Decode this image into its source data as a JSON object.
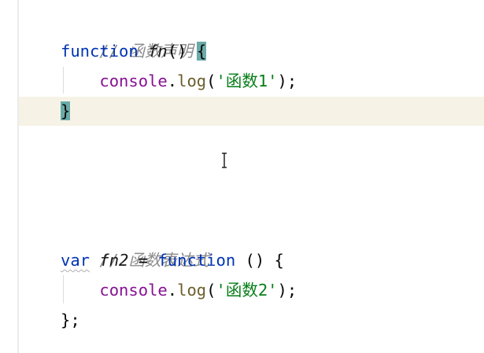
{
  "editor": {
    "lines": [
      {
        "tokens": [
          {
            "text": "// 函数声明"
          }
        ]
      },
      {
        "tokens": [
          {
            "text": "function"
          },
          {
            "text": " "
          },
          {
            "text": "fn"
          },
          {
            "text": "() "
          },
          {
            "text": "{"
          }
        ]
      },
      {
        "tokens": [
          {
            "text": "    "
          },
          {
            "text": "console"
          },
          {
            "text": "."
          },
          {
            "text": "log"
          },
          {
            "text": "("
          },
          {
            "text": "'函数1'"
          },
          {
            "text": ");"
          }
        ]
      },
      {
        "tokens": [
          {
            "text": "}"
          }
        ]
      },
      {
        "tokens": []
      },
      {
        "tokens": []
      },
      {
        "tokens": []
      },
      {
        "tokens": [
          {
            "text": "// 函数表达式"
          }
        ]
      },
      {
        "tokens": [
          {
            "text": "var"
          },
          {
            "text": " "
          },
          {
            "text": "fn2"
          },
          {
            "text": " = "
          },
          {
            "text": "function"
          },
          {
            "text": " () {"
          }
        ]
      },
      {
        "tokens": [
          {
            "text": "    "
          },
          {
            "text": "console"
          },
          {
            "text": "."
          },
          {
            "text": "log"
          },
          {
            "text": "("
          },
          {
            "text": "'函数2'"
          },
          {
            "text": ");"
          }
        ]
      },
      {
        "tokens": [
          {
            "text": "};"
          }
        ]
      }
    ],
    "cursor_icon": "text-cursor-ibeam-icon",
    "colors": {
      "keyword": "#0033b3",
      "string": "#067d17",
      "comment": "#8c8c8c",
      "brace_match": "#6aaaa8",
      "current_line": "#f6f3e6"
    }
  }
}
